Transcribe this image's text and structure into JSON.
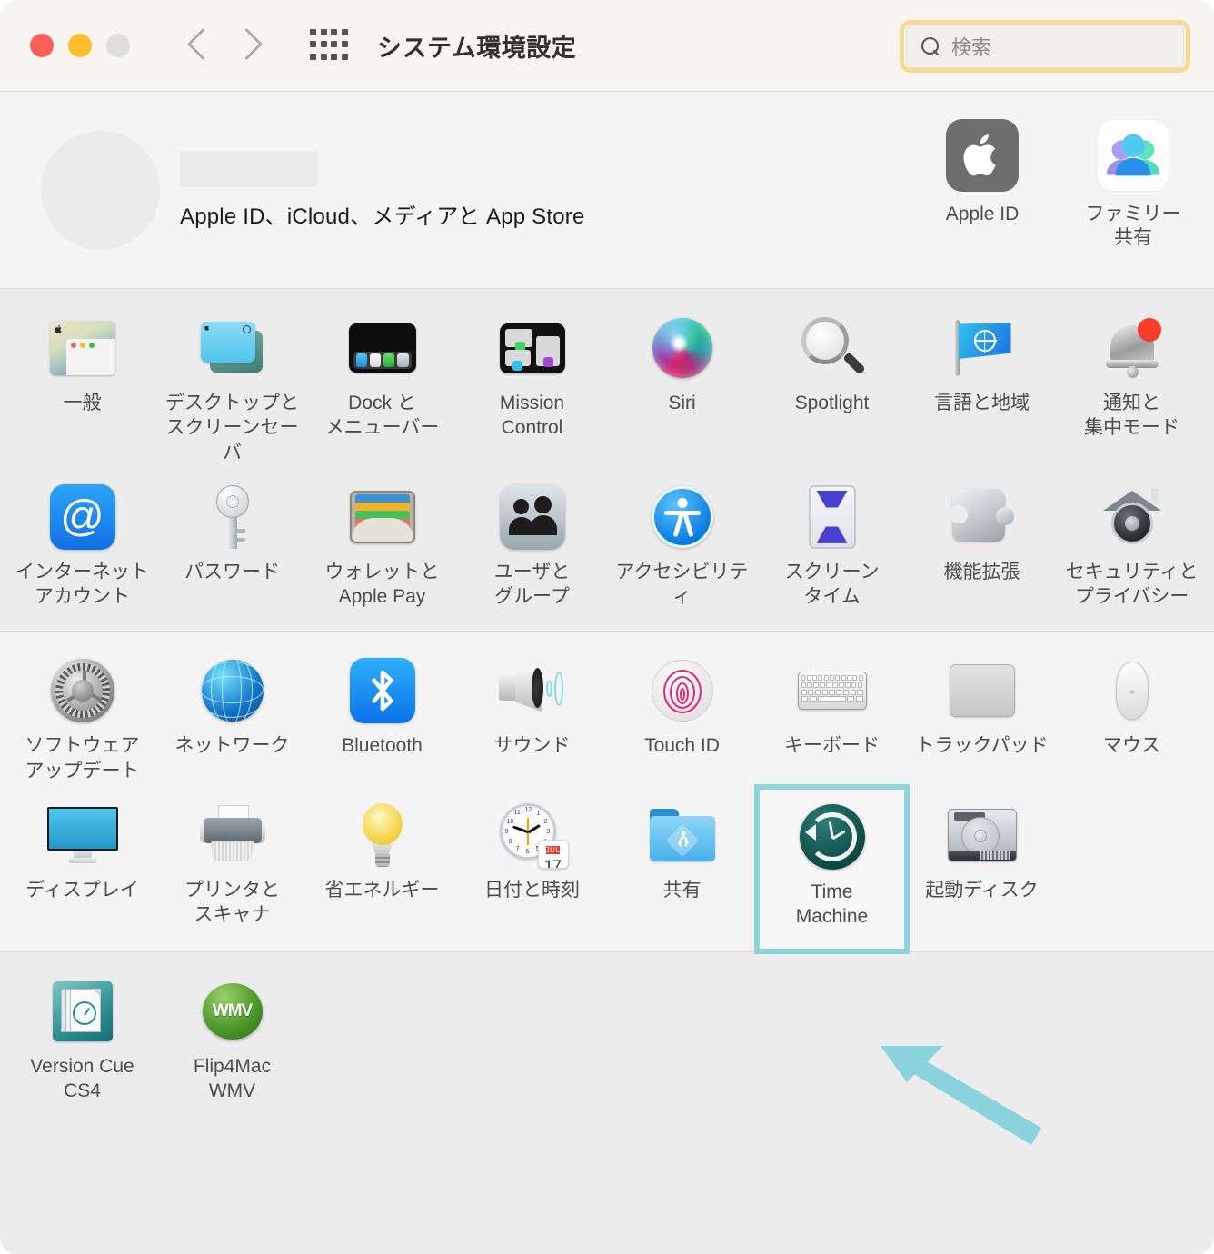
{
  "window": {
    "title": "システム環境設定",
    "traffic_lights": [
      "close",
      "minimize",
      "zoom"
    ],
    "nav_back": "‹",
    "nav_forward": "›",
    "grid_button": "show-all-grid"
  },
  "search": {
    "placeholder": "検索",
    "value": "",
    "icon": "search-icon",
    "focus_ring_color": "#f5d995"
  },
  "account": {
    "name_redacted": "",
    "subtitle": "Apple ID、iCloud、メディアと App Store",
    "shortcuts": [
      {
        "label": "Apple ID",
        "icon": "apple-logo-icon"
      },
      {
        "label": "ファミリー\n共有",
        "label_line1": "ファミリー",
        "label_line2": "共有",
        "icon": "family-sharing-icon"
      }
    ]
  },
  "groups": [
    {
      "id": "personal",
      "items": [
        {
          "label1": "一般",
          "label2": "",
          "icon": "general-icon"
        },
        {
          "label1": "デスクトップと",
          "label2": "スクリーンセーバ",
          "icon": "desktop-screensaver-icon"
        },
        {
          "label1": "Dock と",
          "label2": "メニューバー",
          "icon": "dock-menubar-icon"
        },
        {
          "label1": "Mission",
          "label2": "Control",
          "icon": "mission-control-icon"
        },
        {
          "label1": "Siri",
          "label2": "",
          "icon": "siri-icon"
        },
        {
          "label1": "Spotlight",
          "label2": "",
          "icon": "spotlight-icon"
        },
        {
          "label1": "言語と地域",
          "label2": "",
          "icon": "language-region-icon"
        },
        {
          "label1": "通知と",
          "label2": "集中モード",
          "icon": "notifications-icon"
        },
        {
          "label1": "インターネット",
          "label2": "アカウント",
          "icon": "internet-accounts-icon"
        },
        {
          "label1": "パスワード",
          "label2": "",
          "icon": "passwords-key-icon"
        },
        {
          "label1": "ウォレットと",
          "label2": "Apple Pay",
          "icon": "wallet-icon"
        },
        {
          "label1": "ユーザと",
          "label2": "グループ",
          "icon": "users-groups-icon"
        },
        {
          "label1": "アクセシビリティ",
          "label2": "",
          "icon": "accessibility-icon"
        },
        {
          "label1": "スクリーン",
          "label2": "タイム",
          "icon": "screen-time-icon"
        },
        {
          "label1": "機能拡張",
          "label2": "",
          "icon": "extensions-icon"
        },
        {
          "label1": "セキュリティと",
          "label2": "プライバシー",
          "icon": "security-privacy-icon"
        }
      ]
    },
    {
      "id": "hardware",
      "items": [
        {
          "label1": "ソフトウェア",
          "label2": "アップデート",
          "icon": "software-update-icon"
        },
        {
          "label1": "ネットワーク",
          "label2": "",
          "icon": "network-icon"
        },
        {
          "label1": "Bluetooth",
          "label2": "",
          "icon": "bluetooth-icon"
        },
        {
          "label1": "サウンド",
          "label2": "",
          "icon": "sound-icon"
        },
        {
          "label1": "Touch ID",
          "label2": "",
          "icon": "touch-id-icon"
        },
        {
          "label1": "キーボード",
          "label2": "",
          "icon": "keyboard-icon"
        },
        {
          "label1": "トラックパッド",
          "label2": "",
          "icon": "trackpad-icon"
        },
        {
          "label1": "マウス",
          "label2": "",
          "icon": "mouse-icon"
        },
        {
          "label1": "ディスプレイ",
          "label2": "",
          "icon": "display-icon"
        },
        {
          "label1": "プリンタと",
          "label2": "スキャナ",
          "icon": "printers-scanners-icon"
        },
        {
          "label1": "省エネルギー",
          "label2": "",
          "icon": "energy-saver-icon"
        },
        {
          "label1": "日付と時刻",
          "label2": "",
          "icon": "date-time-icon"
        },
        {
          "label1": "共有",
          "label2": "",
          "icon": "sharing-icon"
        },
        {
          "label1": "Time",
          "label2": "Machine",
          "icon": "time-machine-icon",
          "highlighted": true
        },
        {
          "label1": "起動ディスク",
          "label2": "",
          "icon": "startup-disk-icon"
        }
      ]
    },
    {
      "id": "third-party",
      "items": [
        {
          "label1": "Version Cue",
          "label2": "CS4",
          "icon": "version-cue-icon"
        },
        {
          "label1": "Flip4Mac",
          "label2": "WMV",
          "icon": "flip4mac-wmv-icon"
        }
      ]
    }
  ],
  "annotation": {
    "highlight_color": "#8cd5dc",
    "arrow_color": "#8bd3dc",
    "arrow_target": "Time Machine",
    "arrow_direction": "up-left"
  },
  "date_time_icon": {
    "month": "JUL",
    "day": "17"
  },
  "flip4mac_badge": "WMV"
}
